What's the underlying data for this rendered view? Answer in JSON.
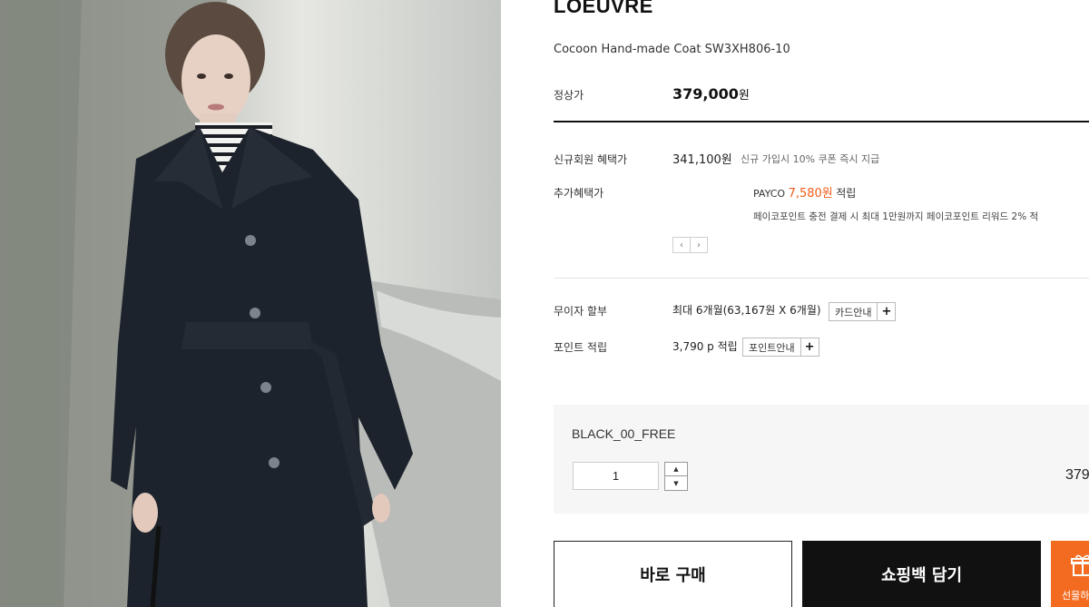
{
  "brand": "LOEUVRE",
  "product": {
    "name": "Cocoon Hand-made Coat SW3XH806-10",
    "regular_price_label": "정상가",
    "regular_price": "379,000",
    "currency": "원"
  },
  "benefits": {
    "member_label": "신규회원 혜택가",
    "member_price": "341,100원",
    "member_note": "신규 가입시 10% 쿠폰 즉시 지급",
    "extra_label": "추가혜택가",
    "payco_prefix": "PAYCO",
    "payco_amount": "7,580원",
    "payco_suffix": "적립",
    "payco_desc": "페이코포인트 충전 결제 시 최대 1만원까지 페이코포인트 리워드 2% 적",
    "prev_label": "‹",
    "next_label": "›"
  },
  "installment": {
    "label": "무이자 할부",
    "value": "최대 6개월(63,167원 X 6개월)",
    "button_label": "카드안내",
    "plus": "+"
  },
  "points": {
    "label": "포인트 적립",
    "value": "3,790 p 적립",
    "button_label": "포인트안내",
    "plus": "+"
  },
  "option": {
    "name": "BLACK_00_FREE",
    "quantity": "1",
    "price": "379",
    "up_icon": "▲",
    "down_icon": "▼"
  },
  "actions": {
    "buy_now": "바로 구매",
    "add_to_cart": "쇼핑백 담기",
    "gift": "선물하"
  },
  "colors": {
    "accent": "#f35b19",
    "gift_bg": "#f36b21",
    "cart_bg": "#111111"
  }
}
